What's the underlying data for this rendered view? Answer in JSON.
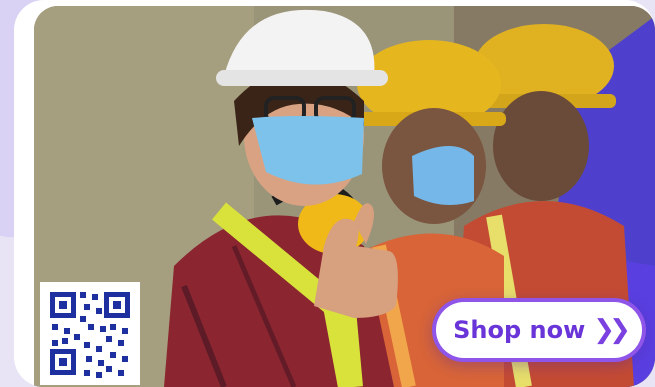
{
  "hero": {
    "cta_label": "Shop now",
    "cta_icon": "double-chevron-right-icon"
  },
  "colors": {
    "accent": "#8f55e8",
    "accent_text": "#6a35d8",
    "page_bg": "#e8e4f6",
    "card_bg": "#ffffff",
    "decor_blue": "#4a3bd6"
  }
}
